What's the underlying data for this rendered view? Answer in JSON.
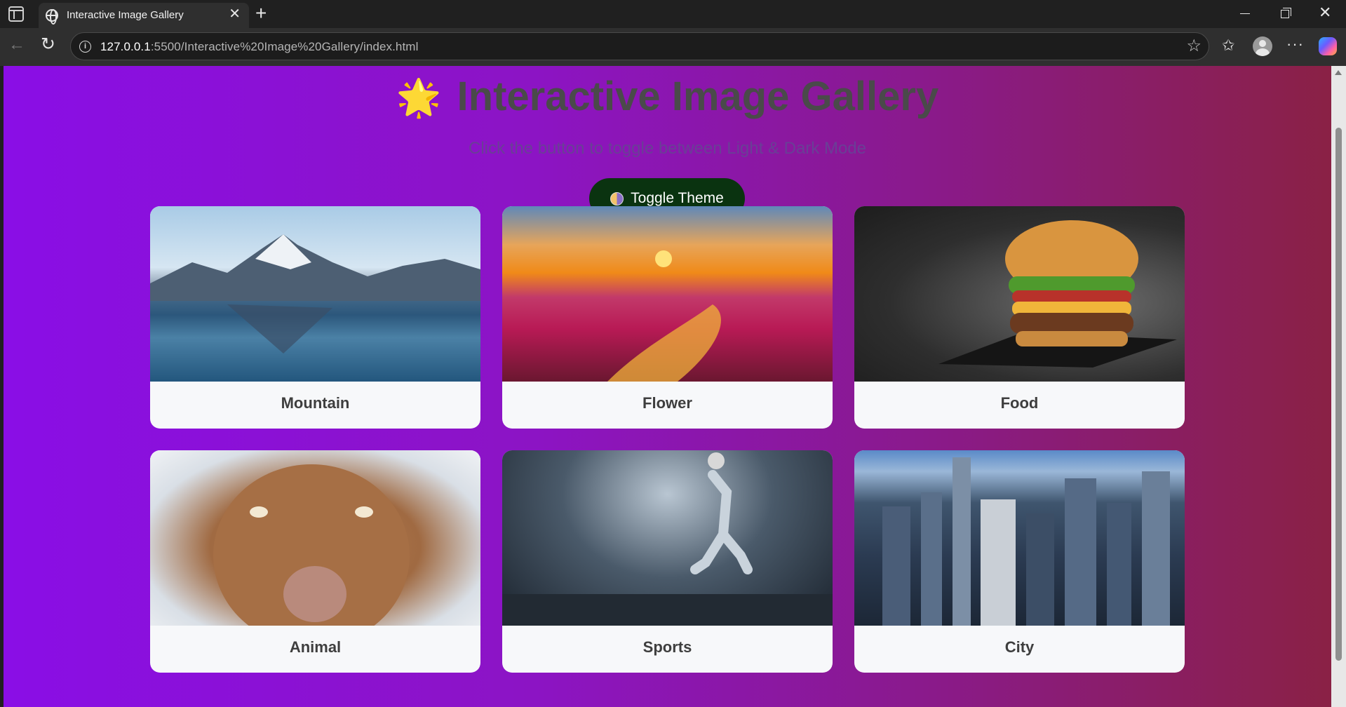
{
  "browser": {
    "tab_title": "Interactive Image Gallery",
    "url_host": "127.0.0.1",
    "url_path": ":5500/Interactive%20Image%20Gallery/index.html"
  },
  "page": {
    "title": "Interactive Image Gallery",
    "subtitle": "Click the button to toggle between Light & Dark Mode",
    "toggle_label": "Toggle Theme"
  },
  "gallery": [
    {
      "label": "Mountain"
    },
    {
      "label": "Flower"
    },
    {
      "label": "Food"
    },
    {
      "label": "Animal"
    },
    {
      "label": "Sports"
    },
    {
      "label": "City"
    }
  ],
  "icons": {
    "title_icon": "sparkle-star-icon",
    "toggle_icon": "half-moon-icon"
  },
  "colors": {
    "background_gradient_start": "#8a0ee6",
    "background_gradient_end": "#8a2145",
    "toggle_button": "#0a3310",
    "card": "#f7f8fa"
  }
}
